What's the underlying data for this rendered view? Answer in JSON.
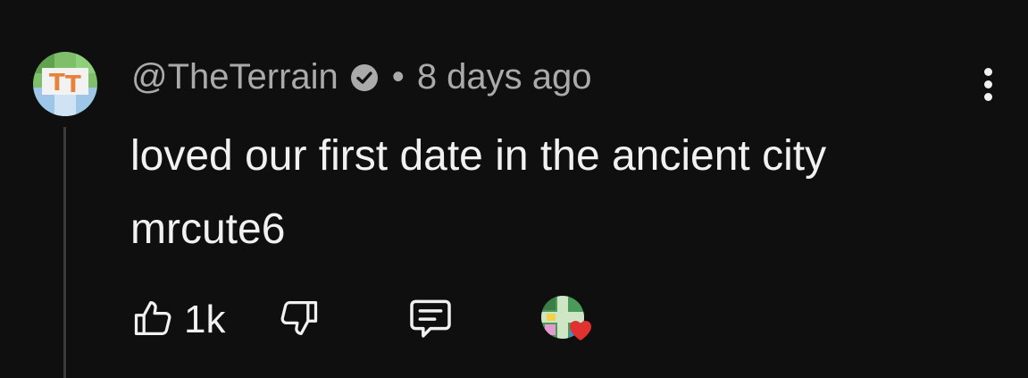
{
  "comment": {
    "author": "@TheTerrain",
    "time": "8 days ago",
    "separator": "•",
    "text": "loved our first date in the ancient city mrcute6",
    "like_count": "1k"
  },
  "colors": {
    "background": "#0f0f0f",
    "text_primary": "#f1f1f1",
    "text_secondary": "#aaaaaa",
    "heart": "#e2322f"
  },
  "icons": {
    "verified": "verified-check-icon",
    "like": "thumbs-up-icon",
    "dislike": "thumbs-down-icon",
    "reply": "reply-comment-icon",
    "more": "more-vertical-icon",
    "creator_heart": "creator-heart-icon"
  }
}
